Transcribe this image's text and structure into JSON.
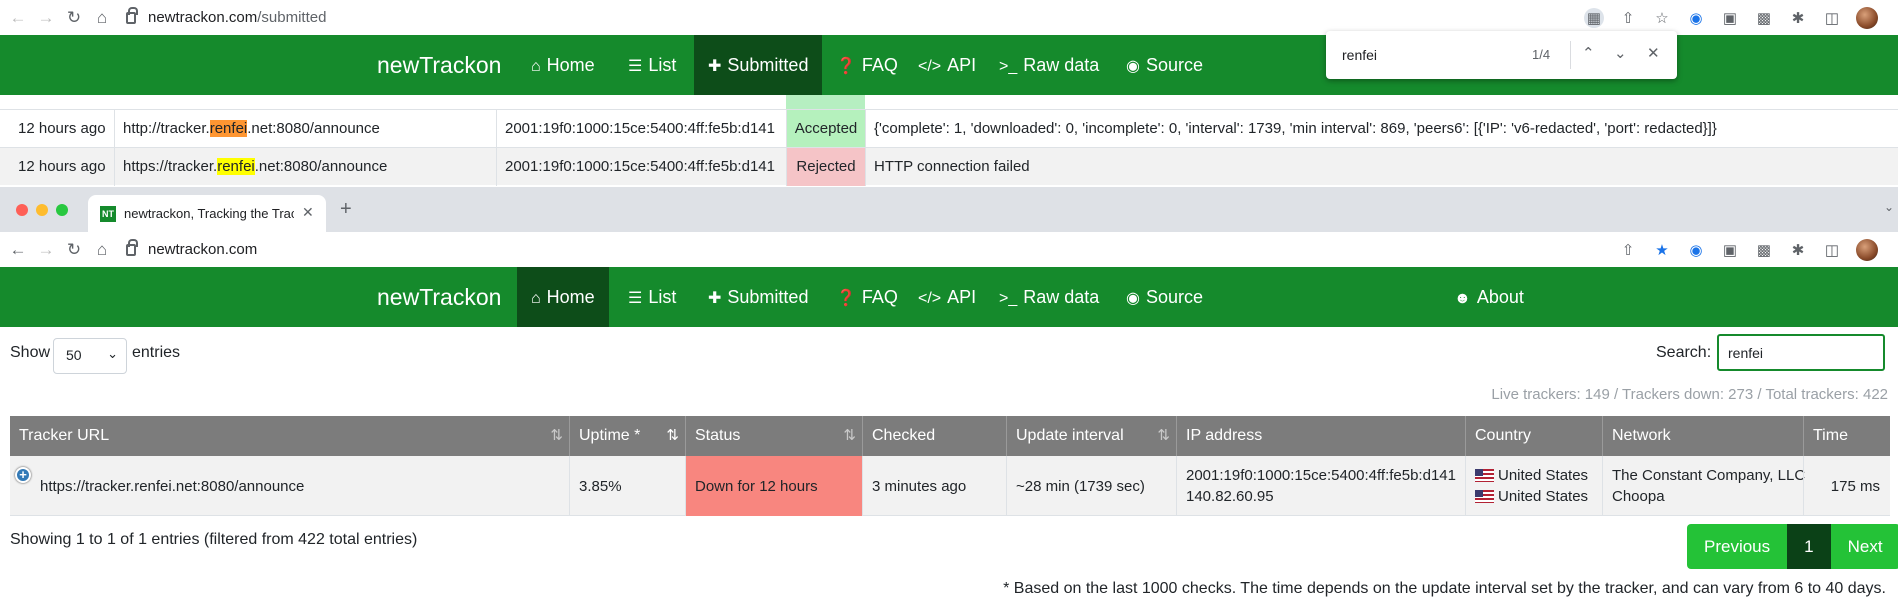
{
  "top_browser": {
    "url_domain": "newtrackon.com",
    "url_path": "/submitted"
  },
  "find_bar": {
    "query": "renfei",
    "count": "1/4"
  },
  "nav": {
    "brand": "newTrackon",
    "home": "Home",
    "list": "List",
    "submitted": "Submitted",
    "faq": "FAQ",
    "api": "API",
    "raw_data": "Raw data",
    "source": "Source",
    "about": "About"
  },
  "submitted_rows": [
    {
      "time": "12 hours ago",
      "url_pre": "http://tracker.",
      "url_match": "renfei",
      "url_post": ".net:8080/announce",
      "ip": "2001:19f0:1000:15ce:5400:4ff:fe5b:d141",
      "status": "Accepted",
      "result": "{'complete': 1, 'downloaded': 0, 'incomplete': 0, 'interval': 1739, 'min interval': 869, 'peers6': [{'IP': 'v6-redacted', 'port': redacted}]}"
    },
    {
      "time": "12 hours ago",
      "url_pre": "https://tracker.",
      "url_match": "renfei",
      "url_post": ".net:8080/announce",
      "ip": "2001:19f0:1000:15ce:5400:4ff:fe5b:d141",
      "status": "Rejected",
      "result": "HTTP connection failed"
    }
  ],
  "second_browser": {
    "tab_favicon": "NT",
    "tab_title": "newtrackon, Tracking the Track",
    "url_domain": "newtrackon.com"
  },
  "table_controls": {
    "show_label": "Show",
    "entries_value": "50",
    "entries_label": "entries",
    "search_label": "Search:",
    "search_value": "renfei",
    "stats": "Live trackers: 149 / Trackers down: 273 / Total trackers: 422"
  },
  "columns": {
    "tracker_url": "Tracker URL",
    "uptime": "Uptime *",
    "status": "Status",
    "checked": "Checked",
    "update_interval": "Update interval",
    "ip_address": "IP address",
    "country": "Country",
    "network": "Network",
    "time": "Time"
  },
  "tracker_row": {
    "url": "https://tracker.renfei.net:8080/announce",
    "uptime": "3.85%",
    "status": "Down for 12 hours",
    "checked": "3 minutes ago",
    "update_interval": "~28 min (1739 sec)",
    "ip1": "2001:19f0:1000:15ce:5400:4ff:fe5b:d141",
    "ip2": "140.82.60.95",
    "country1": "United States",
    "country2": "United States",
    "network1": "The Constant Company, LLC",
    "network2": "Choopa",
    "time": "175 ms"
  },
  "pagination": {
    "info": "Showing 1 to 1 of 1 entries (filtered from 422 total entries)",
    "previous": "Previous",
    "page": "1",
    "next": "Next"
  },
  "footnote": "* Based on the last 1000 checks. The time depends on the update interval set by the tracker, and can vary from 6 to 40 days.",
  "colors": {
    "navbar": "#158a2c",
    "navbar_active": "#0d4d19",
    "accepted": "#b5f1bd",
    "rejected": "#f5c4c7",
    "down": "#f8867f",
    "pager": "#24c237"
  }
}
